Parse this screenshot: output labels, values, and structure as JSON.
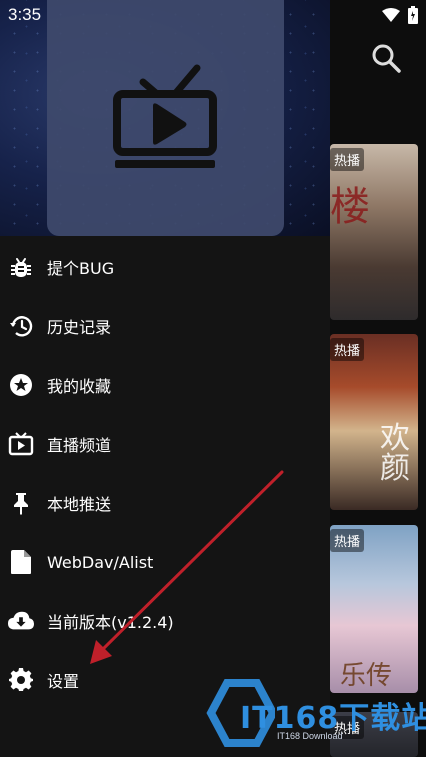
{
  "status_bar": {
    "time": "3:35"
  },
  "posters": [
    {
      "tag": "热播",
      "title": "楼"
    },
    {
      "tag": "热播",
      "title": "欢颜"
    },
    {
      "tag": "热播",
      "title": "乐传"
    },
    {
      "tag": "热播"
    }
  ],
  "drawer": {
    "menu": [
      {
        "label": "提个BUG",
        "icon": "bug-icon"
      },
      {
        "label": "历史记录",
        "icon": "history-icon"
      },
      {
        "label": "我的收藏",
        "icon": "star-icon"
      },
      {
        "label": "直播频道",
        "icon": "tv-icon"
      },
      {
        "label": "本地推送",
        "icon": "pin-icon"
      },
      {
        "label": "WebDav/Alist",
        "icon": "file-icon"
      },
      {
        "label": "当前版本(v1.2.4)",
        "icon": "cloud-download-icon"
      },
      {
        "label": "设置",
        "icon": "gear-icon"
      }
    ]
  },
  "watermark": {
    "main": "IT168下载站",
    "sub": "IT168 Download"
  },
  "colors": {
    "drawer_bg": "#141414",
    "annotation_arrow": "#c0202a",
    "watermark": "#2f8fe0"
  }
}
